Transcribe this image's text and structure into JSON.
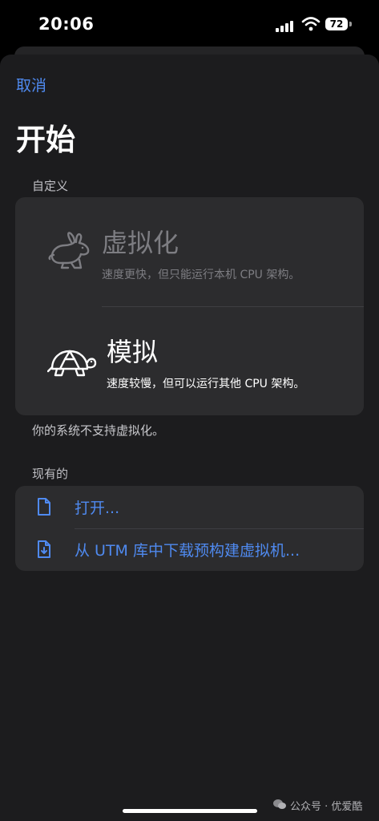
{
  "status_bar": {
    "time": "20:06",
    "battery": "72"
  },
  "nav": {
    "cancel_label": "取消",
    "title": "开始"
  },
  "custom_section": {
    "label": "自定义",
    "options": [
      {
        "title": "虚拟化",
        "description": "速度更快，但只能运行本机 CPU 架构。",
        "icon": "rabbit-icon",
        "enabled": false
      },
      {
        "title": "模拟",
        "description": "速度较慢，但可以运行其他 CPU 架构。",
        "icon": "turtle-icon",
        "enabled": true
      }
    ],
    "footer_note": "你的系统不支持虚拟化。"
  },
  "existing_section": {
    "label": "现有的",
    "items": [
      {
        "label": "打开...",
        "icon": "document-icon"
      },
      {
        "label": "从 UTM 库中下载预构建虚拟机...",
        "icon": "document-download-icon"
      }
    ]
  },
  "watermark": {
    "text": "公众号 · 优爱酷"
  },
  "colors": {
    "accent": "#4f8af0",
    "background": "#1c1c1e",
    "card": "#2c2c2e",
    "disabled_text": "#7d7d82"
  }
}
